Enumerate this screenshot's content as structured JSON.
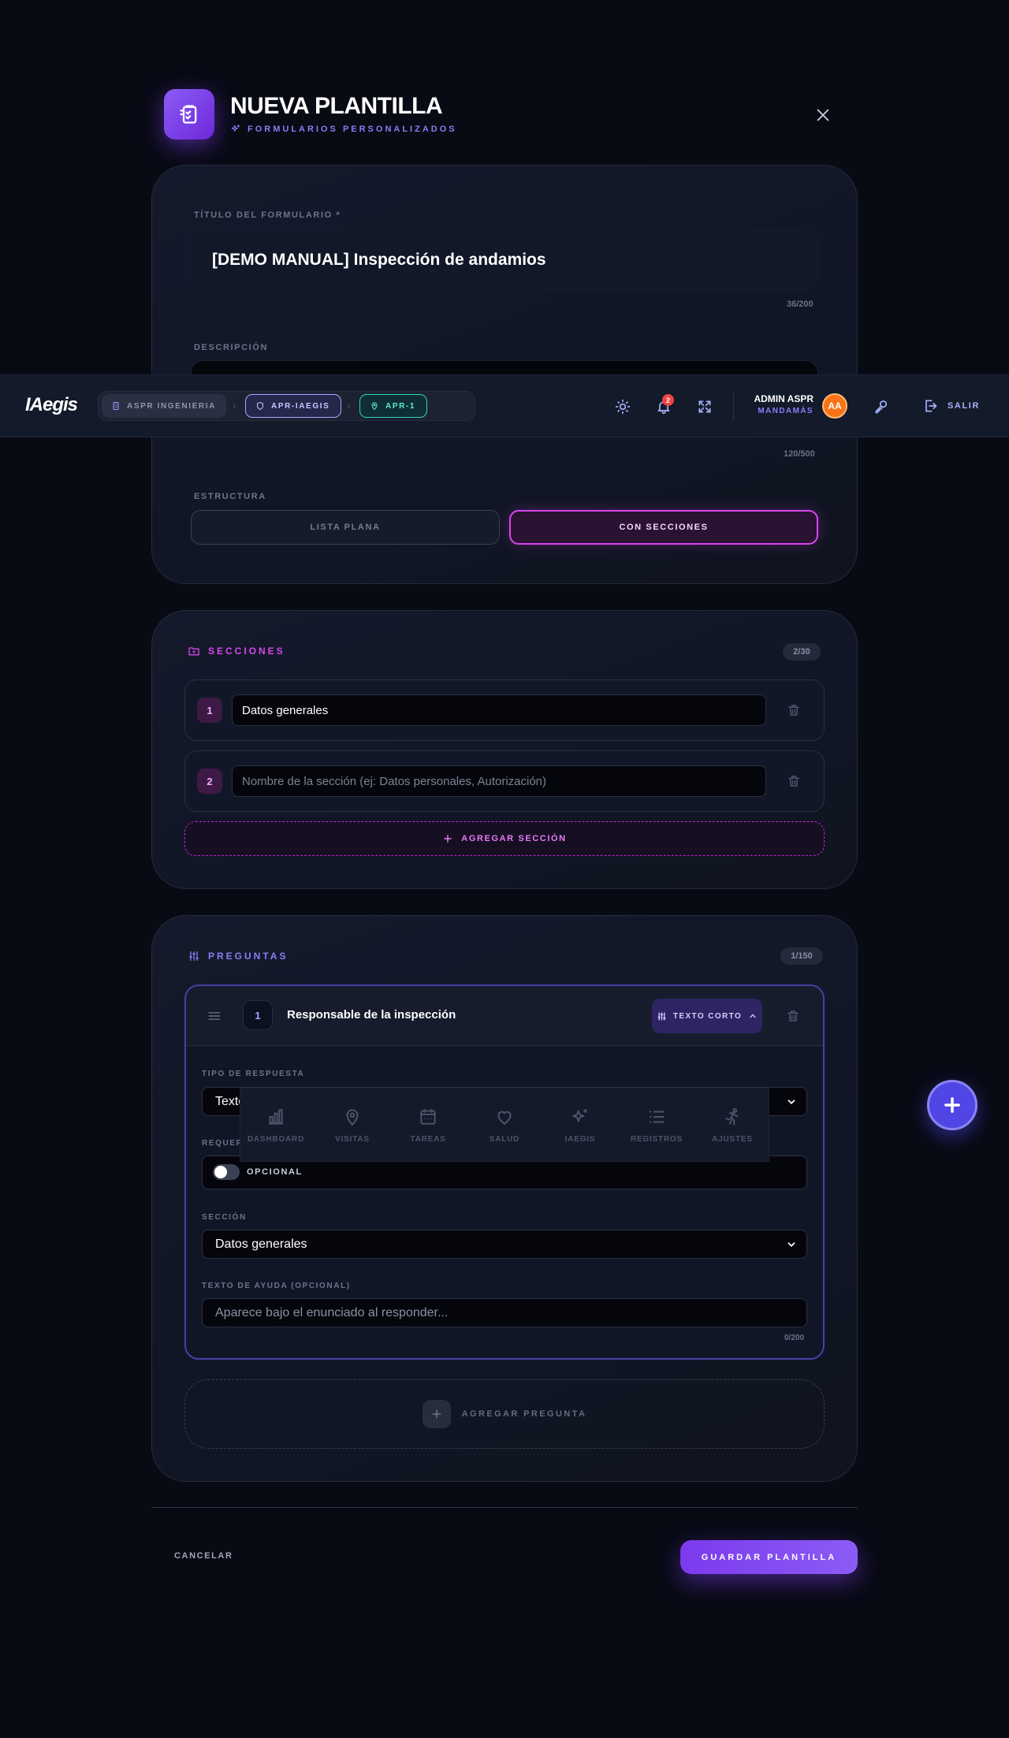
{
  "header": {
    "title": "NUEVA PLANTILLA",
    "subtitle": "FORMULARIOS PERSONALIZADOS"
  },
  "form": {
    "title_label": "TÍTULO DEL FORMULARIO *",
    "title_value": "[DEMO MANUAL] Inspección de andamios",
    "title_counter": "36/200",
    "description_label": "DESCRIPCIÓN",
    "description_counter": "120/500",
    "structure_label": "ESTRUCTURA",
    "structure_options": [
      "LISTA PLANA",
      "CON SECCIONES"
    ],
    "structure_selected": "CON SECCIONES"
  },
  "navbar": {
    "logo": "IAegis",
    "breadcrumbs": [
      "ASPR INGENIERIA",
      "APR-IAEGIS",
      "APR-1"
    ],
    "notifications_count": "2",
    "user_name": "ADMIN ASPR",
    "user_org": "MANDAMÁS",
    "avatar_initials": "AA",
    "logout_label": "SALIR"
  },
  "sections": {
    "header": "SECCIONES",
    "count": "2/30",
    "items": [
      {
        "number": "1",
        "value": "Datos generales",
        "placeholder": ""
      },
      {
        "number": "2",
        "value": "",
        "placeholder": "Nombre de la sección (ej: Datos personales, Autorización)"
      }
    ],
    "add_label": "AGREGAR SECCIÓN"
  },
  "questions": {
    "header": "PREGUNTAS",
    "count": "1/150",
    "items": [
      {
        "number": "1",
        "title": "Responsable de la inspección",
        "type_chip": "TEXTO CORTO",
        "response_type_label": "TIPO DE RESPUESTA",
        "response_type_value": "Texto",
        "required_label": "REQUERI",
        "required_state": "OPCIONAL",
        "section_label": "SECCIÓN",
        "section_value": "Datos generales",
        "help_label": "TEXTO DE AYUDA (OPCIONAL)",
        "help_placeholder": "Aparece bajo el enunciado al responder...",
        "help_counter": "0/200"
      }
    ],
    "add_label": "AGREGAR PREGUNTA"
  },
  "tabbar": {
    "tabs": [
      {
        "label": "DASHBOARD",
        "icon": "bar-chart-icon"
      },
      {
        "label": "VISITAS",
        "icon": "map-pin-icon"
      },
      {
        "label": "TAREAS",
        "icon": "calendar-icon"
      },
      {
        "label": "SALUD",
        "icon": "heart-icon"
      },
      {
        "label": "IAEGIS",
        "icon": "sparkles-icon"
      },
      {
        "label": "REGISTROS",
        "icon": "list-icon"
      },
      {
        "label": "AJUSTES",
        "icon": "running-person-icon"
      }
    ]
  },
  "footer": {
    "cancel_label": "CANCELAR",
    "save_label": "GUARDAR PLANTILLA"
  },
  "colors": {
    "background": "#080a14",
    "accent_violet": "#7c3aed",
    "accent_magenta": "#d946ef",
    "accent_teal": "#2dd4bf",
    "fab": "#4f46e5",
    "notification": "#ef4444",
    "avatar": "#f97316"
  }
}
